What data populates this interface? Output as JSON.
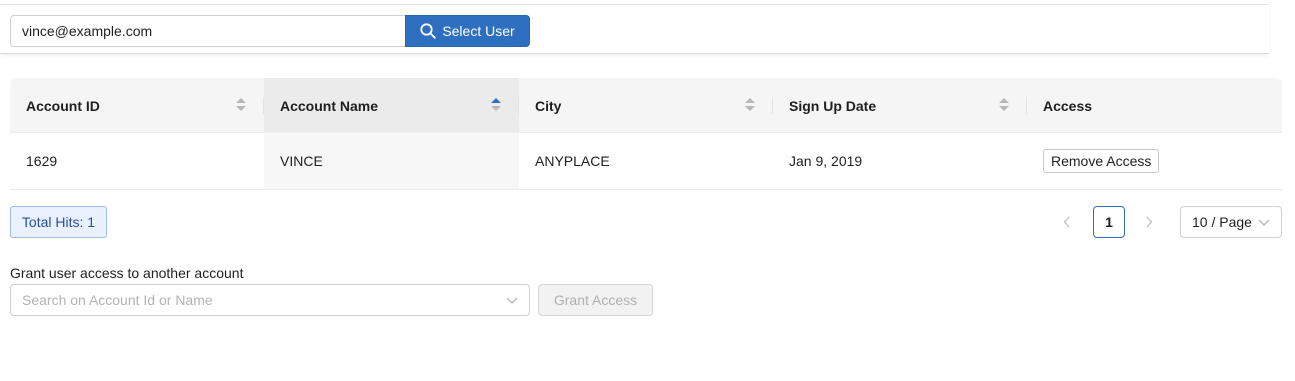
{
  "search": {
    "value": "vince@example.com",
    "button_label": "Select User",
    "button_icon": "search-icon"
  },
  "table": {
    "columns": [
      {
        "label": "Account ID",
        "sortable": true,
        "sort": "none"
      },
      {
        "label": "Account Name",
        "sortable": true,
        "sort": "ascending"
      },
      {
        "label": "City",
        "sortable": true,
        "sort": "none"
      },
      {
        "label": "Sign Up Date",
        "sortable": true,
        "sort": "none"
      },
      {
        "label": "Access",
        "sortable": false
      }
    ],
    "rows": [
      {
        "account_id": "1629",
        "account_name": "VINCE",
        "city": "ANYPLACE",
        "sign_up_date": "Jan 9, 2019",
        "access_button": "Remove Access"
      }
    ]
  },
  "footer": {
    "total_hits": "Total Hits: 1",
    "current_page": "1",
    "page_size": "10 / Page"
  },
  "grant": {
    "label": "Grant user access to another account",
    "placeholder": "Search on Account Id or Name",
    "button_label": "Grant Access",
    "button_disabled": true
  },
  "colors": {
    "primary": "#2f6fc0",
    "hits_bg": "#e8f1fd",
    "header_bg": "#f5f5f5"
  }
}
